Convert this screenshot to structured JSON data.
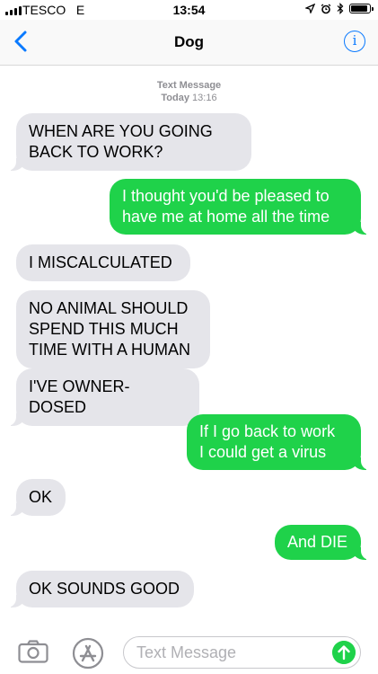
{
  "status_bar": {
    "carrier": "TESCO",
    "network": "E",
    "time": "13:54"
  },
  "nav": {
    "title": "Dog",
    "info_glyph": "i"
  },
  "timestamp": {
    "label": "Text Message",
    "day": "Today",
    "time": "13:16"
  },
  "messages": [
    {
      "direction": "incoming",
      "text": "WHEN ARE YOU GOING\nBACK TO WORK?"
    },
    {
      "direction": "outgoing",
      "text": "I thought you'd be pleased to\nhave me at home all the time"
    },
    {
      "direction": "incoming",
      "text": "I MISCALCULATED"
    },
    {
      "direction": "incoming",
      "text": "NO ANIMAL SHOULD\nSPEND THIS MUCH\nTIME WITH A HUMAN"
    },
    {
      "direction": "incoming",
      "text": "I'VE OWNER-DOSED"
    },
    {
      "direction": "outgoing",
      "text": "If I go back to work\nI could get a virus"
    },
    {
      "direction": "incoming",
      "text": "OK"
    },
    {
      "direction": "outgoing",
      "text": "And DIE"
    },
    {
      "direction": "incoming",
      "text": "OK SOUNDS GOOD"
    }
  ],
  "composer": {
    "placeholder": "Text Message"
  },
  "colors": {
    "accent": "#0a7aff",
    "outgoing": "#1fd24a",
    "incoming": "#e5e5ea"
  },
  "icons": [
    "signal-icon",
    "location-icon",
    "alarm-icon",
    "bluetooth-icon",
    "battery-icon",
    "back-chevron-icon",
    "info-icon",
    "camera-icon",
    "app-store-icon",
    "send-arrow-icon"
  ]
}
